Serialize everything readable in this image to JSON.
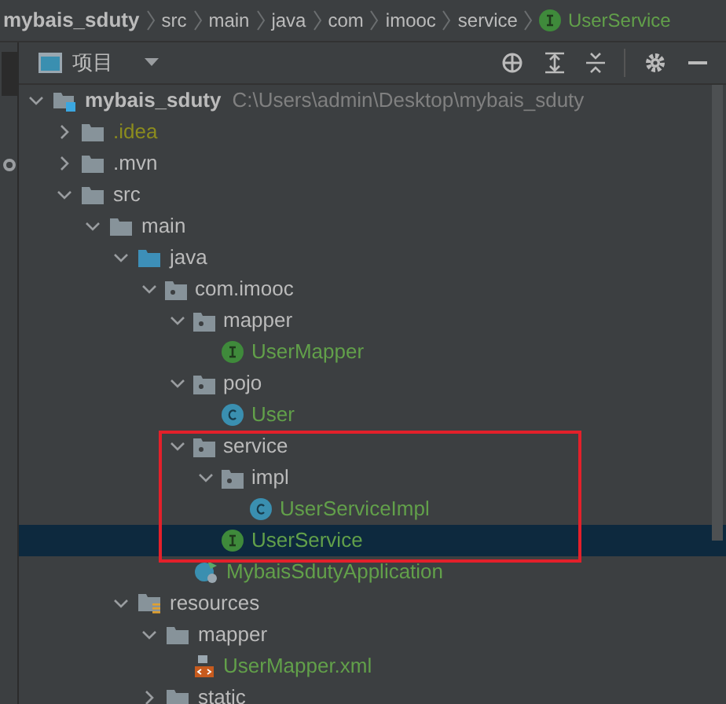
{
  "breadcrumbs": [
    {
      "label": "mybais_sduty",
      "kind": "project"
    },
    {
      "label": "src",
      "kind": "folder"
    },
    {
      "label": "main",
      "kind": "folder"
    },
    {
      "label": "java",
      "kind": "folder"
    },
    {
      "label": "com",
      "kind": "folder"
    },
    {
      "label": "imooc",
      "kind": "folder"
    },
    {
      "label": "service",
      "kind": "folder"
    },
    {
      "label": "UserService",
      "kind": "interface"
    }
  ],
  "panel": {
    "title": "项目"
  },
  "tree": [
    {
      "label": "mybais_sduty",
      "path": "C:\\Users\\admin\\Desktop\\mybais_sduty",
      "kind": "module",
      "expanded": true,
      "selected": false,
      "color": "#bbbbbb",
      "children": [
        {
          "label": ".idea",
          "kind": "folder",
          "expanded": false,
          "selected": false,
          "color": "#8c8c1e"
        },
        {
          "label": ".mvn",
          "kind": "folder",
          "expanded": false,
          "selected": false,
          "color": "#bbbbbb"
        },
        {
          "label": "src",
          "kind": "folder",
          "expanded": true,
          "selected": false,
          "color": "#bbbbbb",
          "children": [
            {
              "label": "main",
              "kind": "folder",
              "expanded": true,
              "selected": false,
              "color": "#bbbbbb",
              "children": [
                {
                  "label": "java",
                  "kind": "source",
                  "expanded": true,
                  "selected": false,
                  "color": "#bbbbbb",
                  "children": [
                    {
                      "label": "com.imooc",
                      "kind": "package",
                      "expanded": true,
                      "selected": false,
                      "color": "#bbbbbb",
                      "children": [
                        {
                          "label": "mapper",
                          "kind": "package",
                          "expanded": true,
                          "selected": false,
                          "color": "#bbbbbb",
                          "children": [
                            {
                              "label": "UserMapper",
                              "kind": "interface",
                              "selected": false,
                              "color": "#62a04a"
                            }
                          ]
                        },
                        {
                          "label": "pojo",
                          "kind": "package",
                          "expanded": true,
                          "selected": false,
                          "color": "#bbbbbb",
                          "children": [
                            {
                              "label": "User",
                              "kind": "class",
                              "selected": false,
                              "color": "#62a04a"
                            }
                          ]
                        },
                        {
                          "label": "service",
                          "kind": "package",
                          "expanded": true,
                          "selected": false,
                          "color": "#bbbbbb",
                          "children": [
                            {
                              "label": "impl",
                              "kind": "package",
                              "expanded": true,
                              "selected": false,
                              "color": "#bbbbbb",
                              "children": [
                                {
                                  "label": "UserServiceImpl",
                                  "kind": "class",
                                  "selected": false,
                                  "color": "#62a04a"
                                }
                              ]
                            },
                            {
                              "label": "UserService",
                              "kind": "interface",
                              "selected": true
                            }
                          ]
                        },
                        {
                          "label": "MybaisSdutyApplication",
                          "kind": "app",
                          "selected": false,
                          "color": "#62a04a"
                        }
                      ]
                    }
                  ]
                },
                {
                  "label": "resources",
                  "kind": "resources",
                  "expanded": true,
                  "selected": false,
                  "color": "#bbbbbb",
                  "children": [
                    {
                      "label": "mapper",
                      "kind": "folder",
                      "expanded": true,
                      "selected": false,
                      "color": "#bbbbbb",
                      "children": [
                        {
                          "label": "UserMapper.xml",
                          "kind": "xml",
                          "selected": false,
                          "color": "#62a04a"
                        }
                      ]
                    },
                    {
                      "label": "static",
                      "kind": "folder",
                      "expanded": false,
                      "selected": false,
                      "color": "#bbbbbb"
                    }
                  ]
                }
              ]
            }
          ]
        }
      ]
    }
  ]
}
